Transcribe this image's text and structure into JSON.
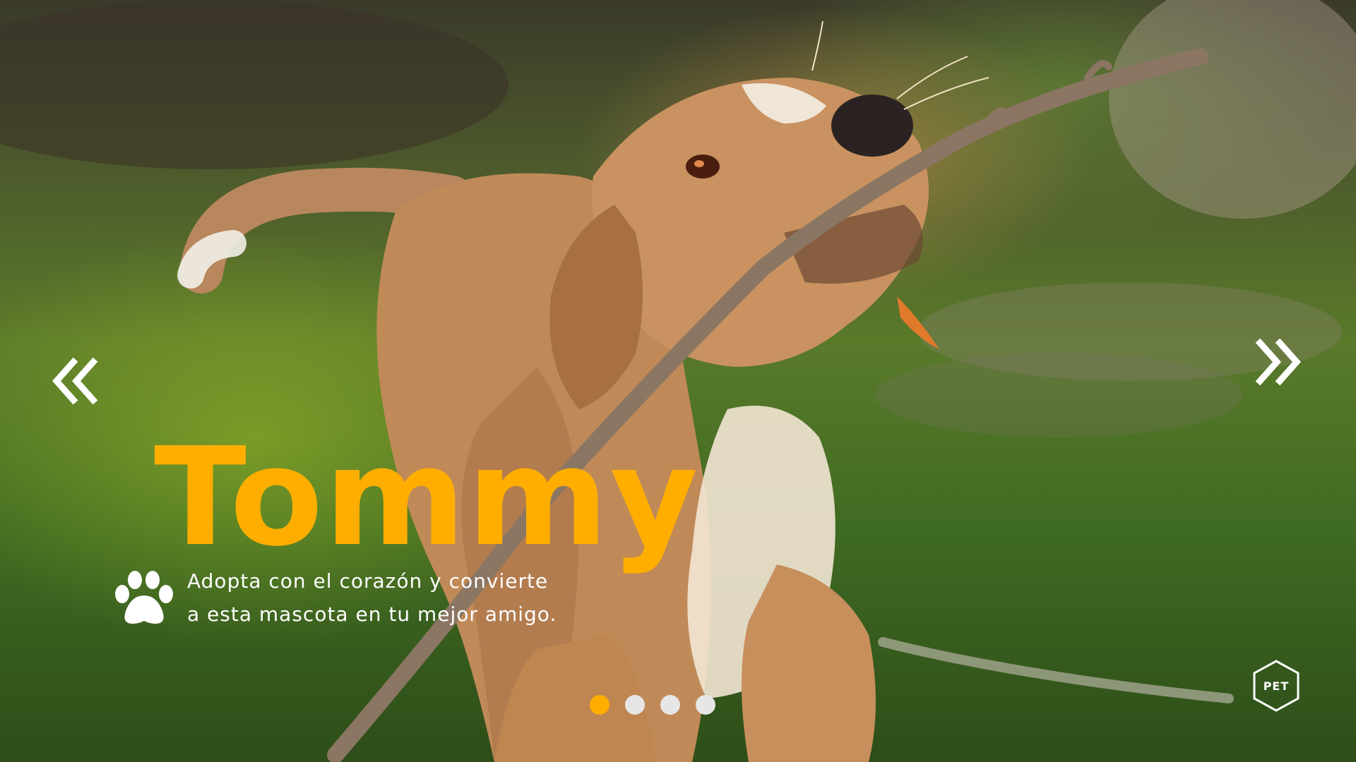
{
  "slide": {
    "title": "Tommy",
    "tagline_line1": "Adopta con el corazón y convierte",
    "tagline_line2": "a esta mascota en tu mejor amigo."
  },
  "navigation": {
    "prev_icon": "double-chevron-left-icon",
    "next_icon": "double-chevron-right-icon"
  },
  "pagination": {
    "total": 4,
    "active_index": 0
  },
  "logo": {
    "text": "PET"
  },
  "colors": {
    "accent": "#ffae00",
    "text": "#ffffff",
    "dot_inactive": "#e6e6e6"
  }
}
